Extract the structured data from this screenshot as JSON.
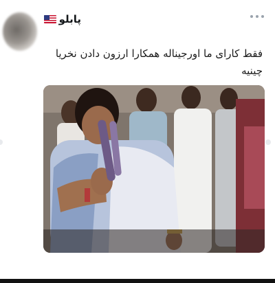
{
  "post": {
    "username": "پابلو",
    "text": "فقط کارای ما اورجیناله همکارا ارزون دادن نخریا چینیه"
  },
  "icons": {
    "flag": "us-flag-icon",
    "more": "more-options-icon",
    "avatar": "avatar"
  },
  "colors": {
    "text": "#1a1a1a",
    "muted": "#9aa3ad",
    "background": "#ffffff"
  }
}
